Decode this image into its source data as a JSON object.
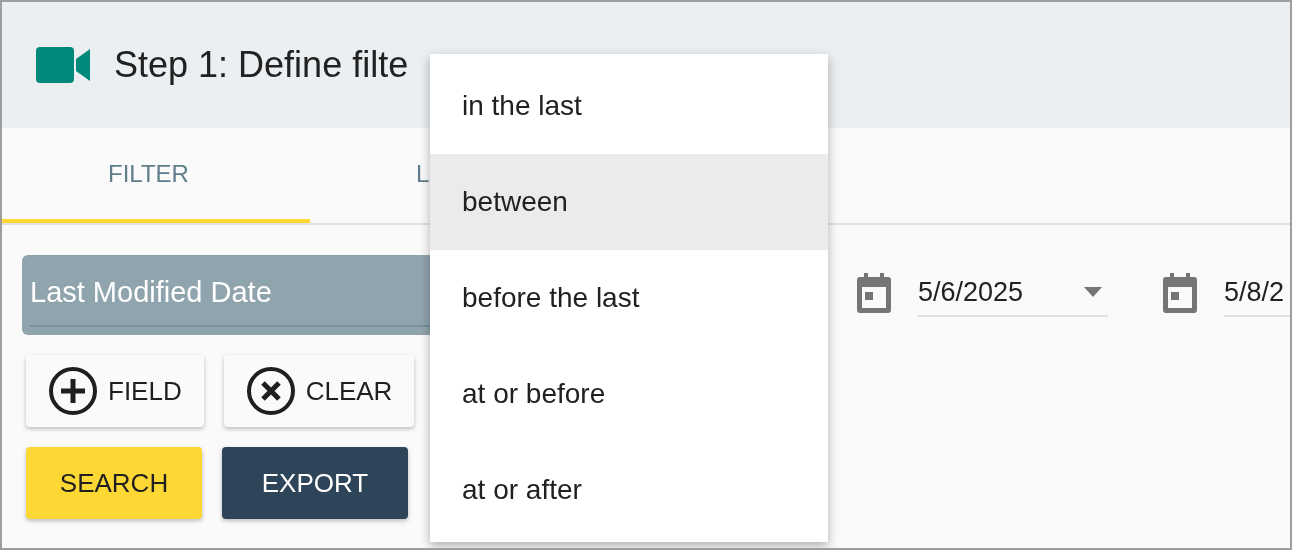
{
  "header": {
    "title": "Step 1: Define filte"
  },
  "tabs": [
    {
      "label": "FILTER",
      "selected": true
    },
    {
      "label": "L",
      "selected": false
    }
  ],
  "filter": {
    "field": {
      "value": "Last Modified Date"
    },
    "dates": [
      {
        "value": "5/6/2025",
        "has_caret": true
      },
      {
        "value": "5/8/2"
      }
    ],
    "tool_buttons": [
      {
        "label": "FIELD",
        "kind": "add"
      },
      {
        "label": "CLEAR",
        "kind": "clear"
      }
    ],
    "action_buttons": [
      {
        "label": "SEARCH",
        "kind": "primary"
      },
      {
        "label": "EXPORT",
        "kind": "dark"
      }
    ]
  },
  "operator_menu": [
    {
      "label": "in the last",
      "selected": false
    },
    {
      "label": "between",
      "selected": true
    },
    {
      "label": "before the last",
      "selected": false
    },
    {
      "label": "at or before",
      "selected": false
    },
    {
      "label": "at or after",
      "selected": false
    }
  ]
}
